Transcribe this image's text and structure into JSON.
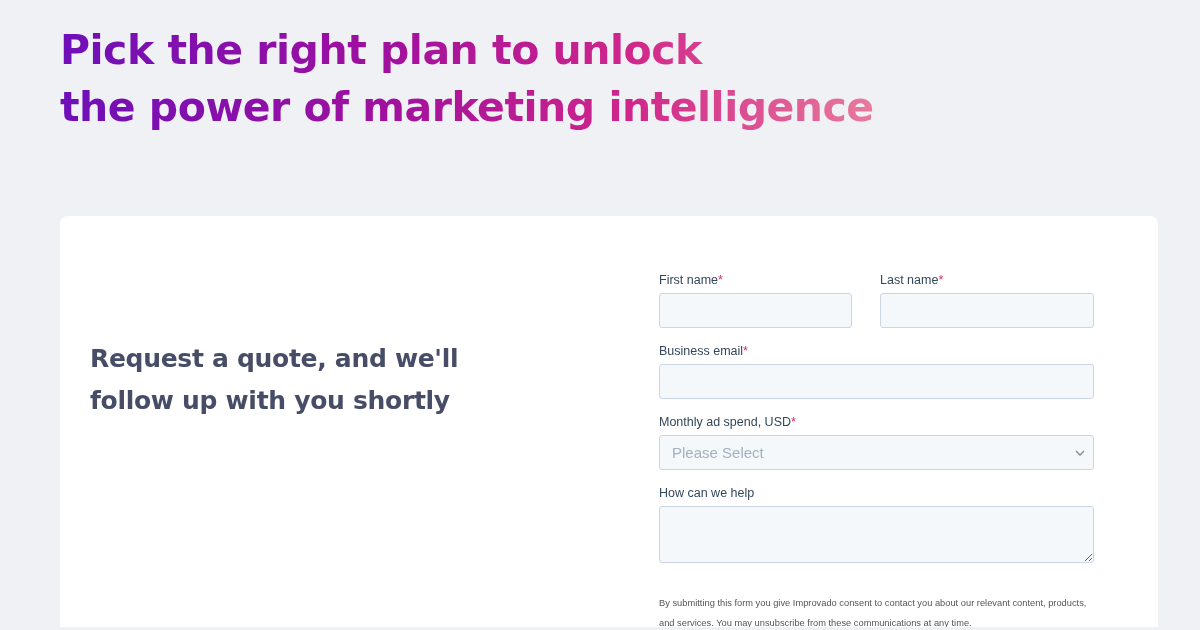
{
  "heading": {
    "lines": [
      "Pick the right plan to unlock",
      "the power of marketing intelligence"
    ]
  },
  "card": {
    "tagline": "Request a quote, and we'll follow up with you shortly",
    "field_rows": [
      [
        {
          "kind": "text",
          "label": "First name",
          "marker": "*"
        },
        {
          "kind": "text",
          "label": "Last name",
          "marker": "*"
        }
      ],
      [
        {
          "kind": "text",
          "label": "Business email",
          "marker": "*"
        }
      ],
      [
        {
          "kind": "select",
          "label": "Monthly ad spend, USD",
          "marker": "*",
          "placeholder": "Please Select"
        }
      ],
      [
        {
          "kind": "textarea",
          "label": "How can we help"
        }
      ]
    ],
    "consent": "By submitting this form you give Improvado consent to contact you about our relevant content, products, and services. You may unsubscribe from these communications at any time."
  }
}
